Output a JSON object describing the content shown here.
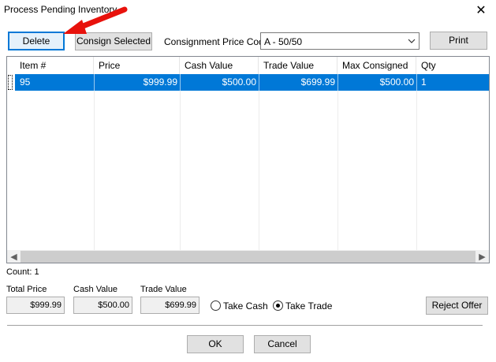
{
  "window": {
    "title": "Process Pending Inventory",
    "close_glyph": "✕"
  },
  "toolbar": {
    "delete_label": "Delete",
    "consign_label": "Consign Selected",
    "price_code_label": "Consignment Price Code",
    "price_code_value": "A - 50/50",
    "print_label": "Print"
  },
  "grid": {
    "columns": [
      "Item #",
      "Price",
      "Cash Value",
      "Trade Value",
      "Max Consigned",
      "Qty"
    ],
    "rows": [
      {
        "item": "95",
        "price": "$999.99",
        "cash": "$500.00",
        "trade": "$699.99",
        "max": "$500.00",
        "qty": "1"
      }
    ],
    "selection_color": "#0078d7"
  },
  "count_label": "Count: 1",
  "summary": {
    "total_label": "Total Price",
    "total_value": "$999.99",
    "cash_label": "Cash Value",
    "cash_value": "$500.00",
    "trade_label": "Trade Value",
    "trade_value": "$699.99"
  },
  "options": {
    "take_cash_label": "Take Cash",
    "take_trade_label": "Take Trade",
    "selected": "take_trade"
  },
  "footer": {
    "reject_label": "Reject Offer",
    "ok_label": "OK",
    "cancel_label": "Cancel"
  },
  "annotation": {
    "arrow_color": "#e8120c"
  }
}
